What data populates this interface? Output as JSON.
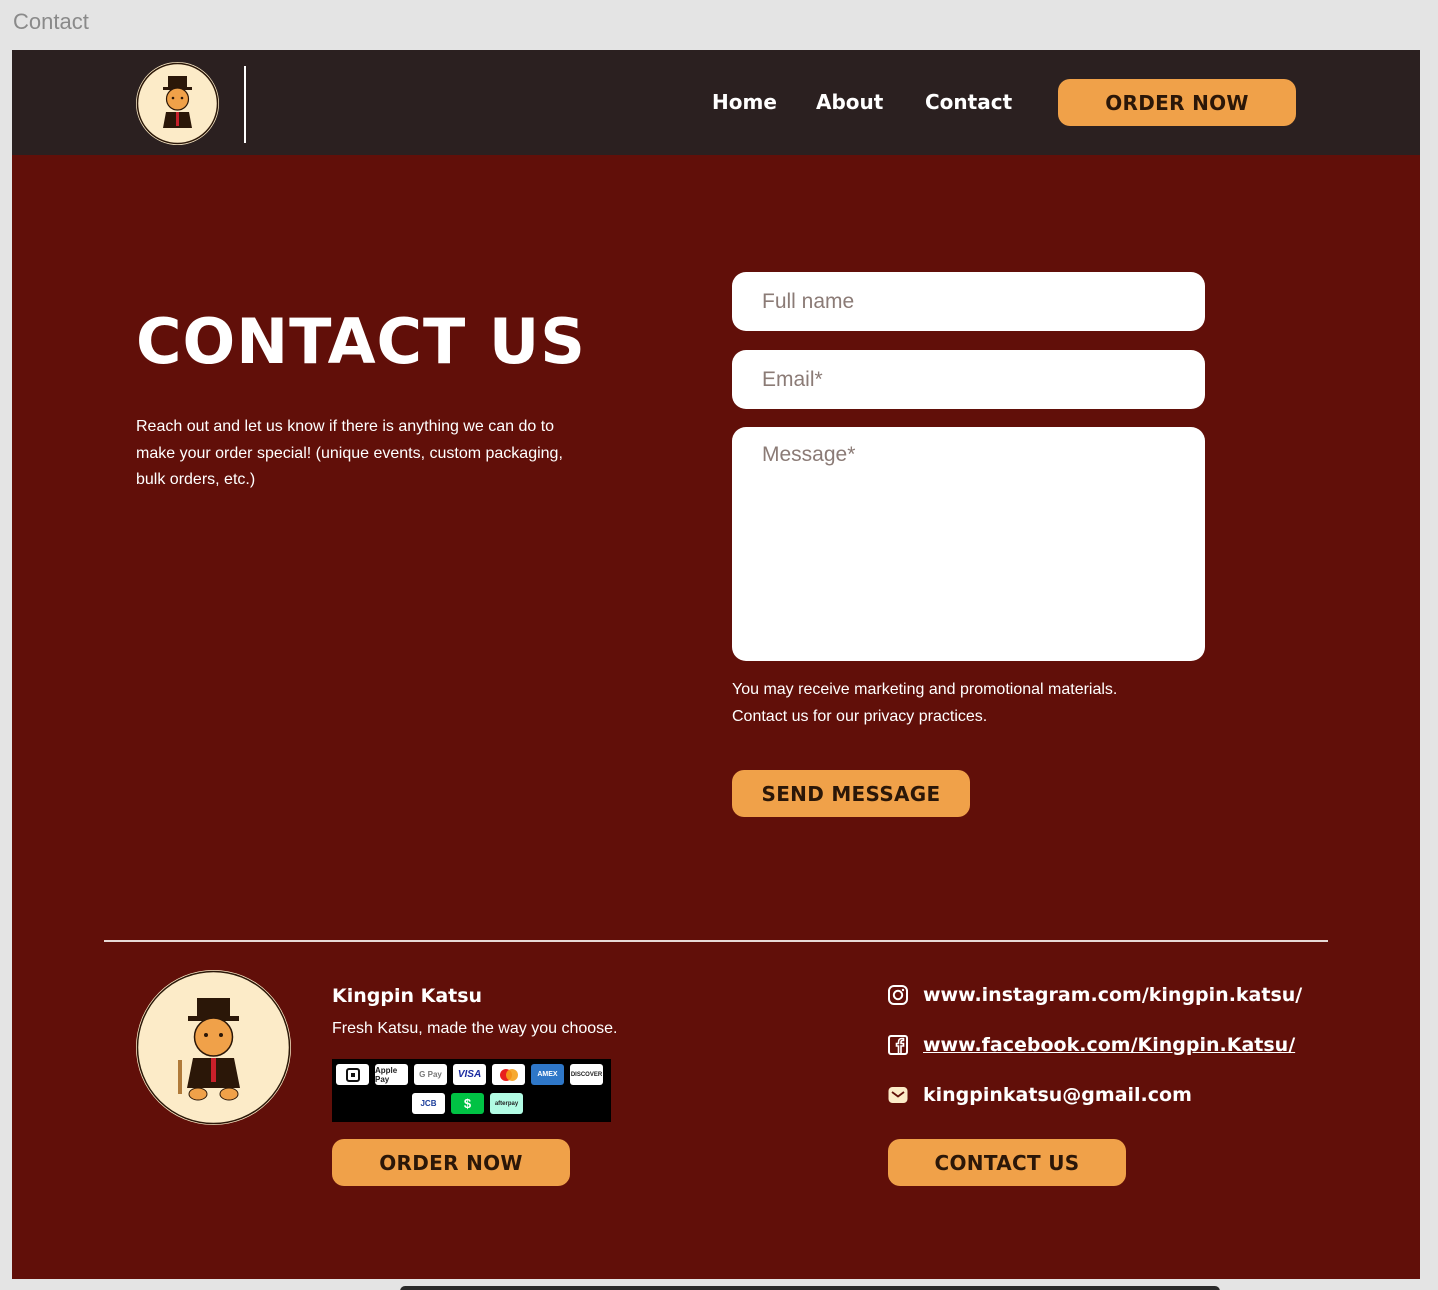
{
  "frame": {
    "title": "Contact"
  },
  "header": {
    "logo_alt": "Kingpin Katsu",
    "nav": [
      {
        "label": "Home"
      },
      {
        "label": "About"
      },
      {
        "label": "Contact"
      }
    ],
    "order_button": "ORDER NOW"
  },
  "hero": {
    "title": "CONTACT US",
    "description": "Reach out and let us know if there is anything we can do to make your order special! (unique events, custom packaging, bulk orders, etc.)"
  },
  "form": {
    "name_placeholder": "Full name",
    "email_placeholder": "Email*",
    "message_placeholder": "Message*",
    "consent_line1": "You may receive marketing and promotional materials.",
    "consent_line2": "Contact us for our privacy practices.",
    "submit_label": "SEND MESSAGE"
  },
  "footer": {
    "brand_name": "Kingpin Katsu",
    "tagline": "Fresh Katsu, made the way you choose.",
    "payment_methods": [
      "Square",
      "Apple Pay",
      "G Pay",
      "VISA",
      "Mastercard",
      "AMEX",
      "DISCOVER",
      "JCB",
      "Cash App",
      "afterpay"
    ],
    "order_button": "ORDER NOW",
    "instagram": "www.instagram.com/kingpin.katsu/",
    "facebook": "www.facebook.com/Kingpin.Katsu/",
    "email": "kingpinkatsu@gmail.com",
    "contact_button": "CONTACT US"
  },
  "colors": {
    "background": "#610f09",
    "header": "#2b2020",
    "accent": "#f0a149",
    "logo_cream": "#fcebc8"
  },
  "icons": [
    "instagram-icon",
    "facebook-icon",
    "mail-icon"
  ]
}
